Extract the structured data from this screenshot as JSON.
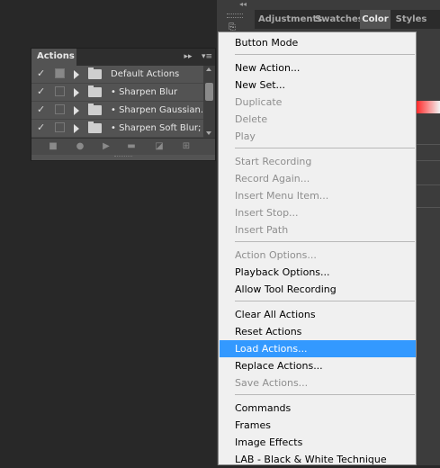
{
  "dock": {
    "tabs": [
      {
        "label": "Adjustments",
        "active": false
      },
      {
        "label": "Swatches",
        "active": false
      },
      {
        "label": "Color",
        "active": true
      },
      {
        "label": "Styles",
        "active": false
      }
    ],
    "collapse_glyph": "◂◂"
  },
  "actions_panel": {
    "title": "Actions",
    "collapse_glyph": "▸▸",
    "menu_glyph": "▾≡",
    "rows": [
      {
        "label": "Default Actions",
        "checked": true,
        "dialog_toggle": true,
        "type": "set"
      },
      {
        "label": "• Sharpen Blur",
        "checked": true,
        "dialog_toggle": false,
        "type": "action"
      },
      {
        "label": "• Sharpen Gaussian...",
        "checked": true,
        "dialog_toggle": false,
        "type": "action"
      },
      {
        "label": "• Sharpen Soft Blur;",
        "checked": true,
        "dialog_toggle": false,
        "type": "action"
      }
    ],
    "footer_icons": [
      "stop-icon",
      "record-icon",
      "play-icon",
      "new-set-icon",
      "new-action-icon",
      "delete-icon"
    ]
  },
  "menu": {
    "groups": [
      [
        {
          "label": "Button Mode",
          "enabled": true
        }
      ],
      [
        {
          "label": "New Action...",
          "enabled": true
        },
        {
          "label": "New Set...",
          "enabled": true
        },
        {
          "label": "Duplicate",
          "enabled": false
        },
        {
          "label": "Delete",
          "enabled": false
        },
        {
          "label": "Play",
          "enabled": false
        }
      ],
      [
        {
          "label": "Start Recording",
          "enabled": false
        },
        {
          "label": "Record Again...",
          "enabled": false
        },
        {
          "label": "Insert Menu Item...",
          "enabled": false
        },
        {
          "label": "Insert Stop...",
          "enabled": false
        },
        {
          "label": "Insert Path",
          "enabled": false
        }
      ],
      [
        {
          "label": "Action Options...",
          "enabled": false
        },
        {
          "label": "Playback Options...",
          "enabled": true
        },
        {
          "label": "Allow Tool Recording",
          "enabled": true
        }
      ],
      [
        {
          "label": "Clear All Actions",
          "enabled": true
        },
        {
          "label": "Reset Actions",
          "enabled": true
        },
        {
          "label": "Load Actions...",
          "enabled": true,
          "highlighted": true
        },
        {
          "label": "Replace Actions...",
          "enabled": true
        },
        {
          "label": "Save Actions...",
          "enabled": false
        }
      ],
      [
        {
          "label": "Commands",
          "enabled": true
        },
        {
          "label": "Frames",
          "enabled": true
        },
        {
          "label": "Image Effects",
          "enabled": true
        },
        {
          "label": "LAB - Black & White Technique",
          "enabled": true
        }
      ]
    ],
    "highlight_color": "#3399ff"
  }
}
